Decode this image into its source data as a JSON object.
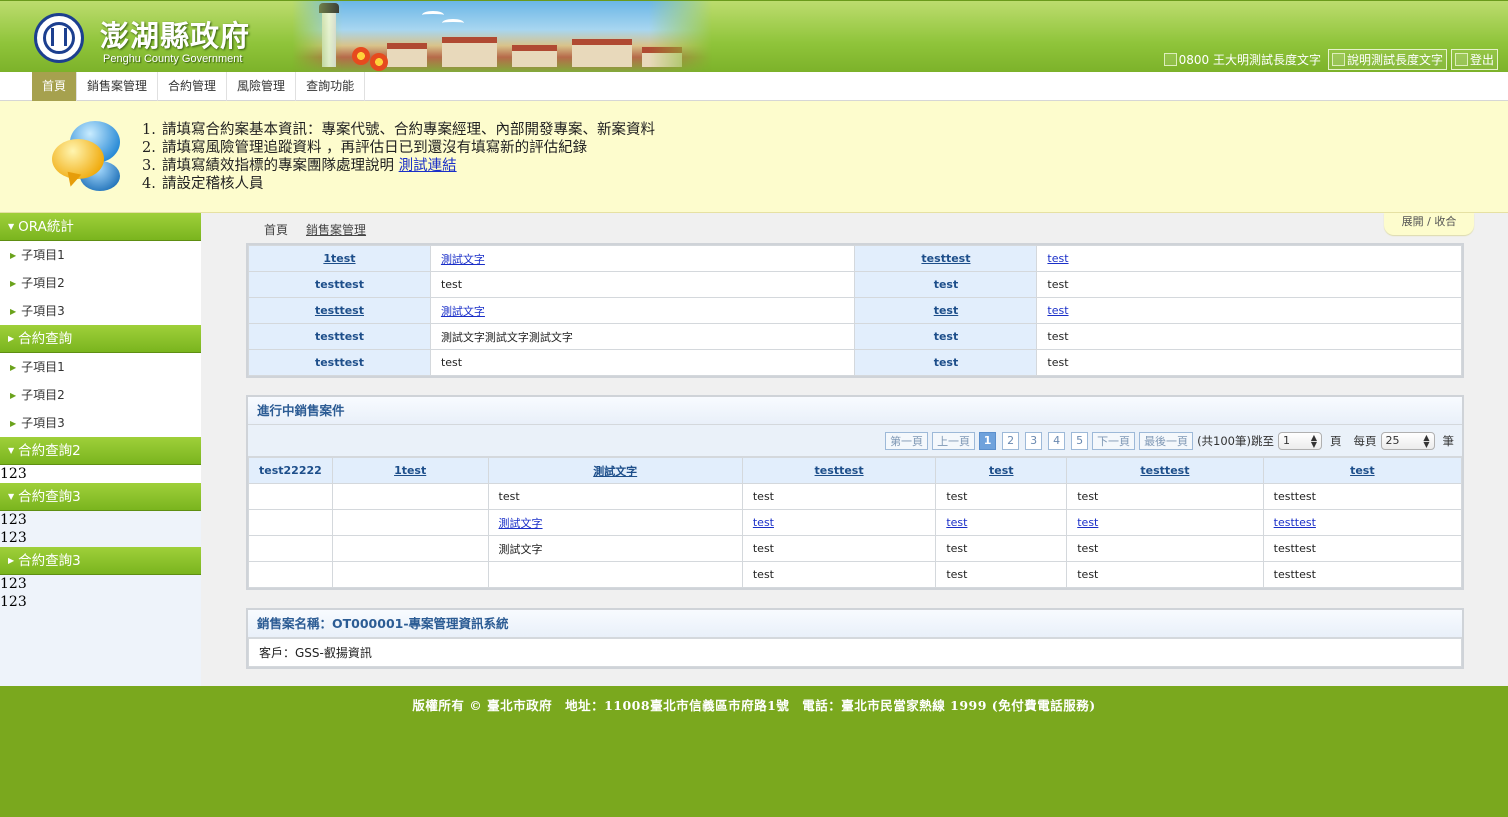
{
  "header": {
    "title": "澎湖縣政府",
    "subtitle": "Penghu County Government",
    "util": [
      {
        "label": "0800 王大明測試長度文字",
        "boxed": false
      },
      {
        "label": "說明測試長度文字",
        "boxed": true
      },
      {
        "label": "登出",
        "boxed": true
      }
    ]
  },
  "nav": {
    "items": [
      "首頁",
      "銷售案管理",
      "合約管理",
      "風險管理",
      "查詢功能"
    ],
    "active_index": 0
  },
  "notice": {
    "items": [
      {
        "num": "1.",
        "text": "請填寫合約案基本資訊：專案代號、合約專案經理、內部開發專案、新案資料",
        "link": ""
      },
      {
        "num": "2.",
        "text": "請填寫風險管理追蹤資料 ，再評估日已到還沒有填寫新的評估紀錄",
        "link": ""
      },
      {
        "num": "3.",
        "text": "請填寫績效指標的專案團隊處理說明 ",
        "link": "測試連結"
      },
      {
        "num": "4.",
        "text": "請設定稽核人員",
        "link": ""
      }
    ]
  },
  "sidebar": {
    "sections": [
      {
        "title": "ORA統計",
        "open": true,
        "items": [
          "子項目1",
          "子項目2",
          "子項目3"
        ],
        "raw": []
      },
      {
        "title": "合約查詢",
        "open": false,
        "items": [
          "子項目1",
          "子項目2",
          "子項目3"
        ],
        "raw": []
      },
      {
        "title": "合約查詢2",
        "open": true,
        "items": [],
        "raw": [
          "123"
        ]
      },
      {
        "title": "合約查詢3",
        "open": true,
        "items": [],
        "raw": [
          "123",
          "123"
        ]
      },
      {
        "title": "合約查詢3",
        "open": false,
        "items": [],
        "raw": [
          "123",
          "123"
        ]
      }
    ]
  },
  "breadcrumb": {
    "home": "首頁",
    "current": "銷售案管理"
  },
  "toggle_label": "展開 / 收合",
  "kv_table": {
    "rows": [
      [
        {
          "t": "1test",
          "k": true,
          "link": true
        },
        {
          "t": "測試文字",
          "link": true
        },
        {
          "t": "testtest",
          "k": true,
          "link": true
        },
        {
          "t": "test",
          "link": true
        }
      ],
      [
        {
          "t": "testtest",
          "k": true
        },
        {
          "t": "test"
        },
        {
          "t": "test",
          "k": true
        },
        {
          "t": "test"
        }
      ],
      [
        {
          "t": "testtest",
          "k": true,
          "link": true
        },
        {
          "t": "測試文字",
          "link": true
        },
        {
          "t": "test",
          "k": true,
          "link": true
        },
        {
          "t": "test",
          "link": true
        }
      ],
      [
        {
          "t": "testtest",
          "k": true
        },
        {
          "t": "測試文字測試文字測試文字"
        },
        {
          "t": "test",
          "k": true
        },
        {
          "t": "test"
        }
      ],
      [
        {
          "t": "testtest",
          "k": true
        },
        {
          "t": "test"
        },
        {
          "t": "test",
          "k": true
        },
        {
          "t": "test"
        }
      ]
    ]
  },
  "ongoing": {
    "title": "進行中銷售案件",
    "pager": {
      "first": "第一頁",
      "prev": "上一頁",
      "pages": [
        "1",
        "2",
        "3",
        "4",
        "5"
      ],
      "current": "1",
      "next": "下一頁",
      "last": "最後一頁",
      "total_text": "(共100筆)跳至",
      "jump_value": "1",
      "page_unit": "頁",
      "per_page_label": "每頁",
      "per_page_value": "25",
      "per_page_unit": "筆"
    },
    "columns": [
      "test22222",
      "1test",
      "測試文字",
      "testtest",
      "test",
      "testtest",
      "test"
    ],
    "column_links": [
      false,
      true,
      true,
      true,
      true,
      true,
      true
    ],
    "rows": [
      {
        "link": false,
        "cells": [
          "",
          "",
          "test",
          "test",
          "test",
          "test",
          "testtest"
        ]
      },
      {
        "link": true,
        "cells": [
          "",
          "",
          "測試文字",
          "test",
          "test",
          "test",
          "testtest"
        ]
      },
      {
        "link": false,
        "cells": [
          "",
          "",
          "測試文字",
          "test",
          "test",
          "test",
          "testtest"
        ]
      },
      {
        "link": false,
        "cells": [
          "",
          "",
          "",
          "test",
          "test",
          "test",
          "testtest"
        ]
      }
    ]
  },
  "case_info": {
    "title": "銷售案名稱：OT000001-專案管理資訊系統",
    "customer": "客戶：GSS-叡揚資訊"
  },
  "footer": {
    "text": "版權所有 © 臺北市政府　地址：11008臺北市信義區市府路1號　電話：臺北市民當家熱線 1999 (免付費電話服務)"
  }
}
